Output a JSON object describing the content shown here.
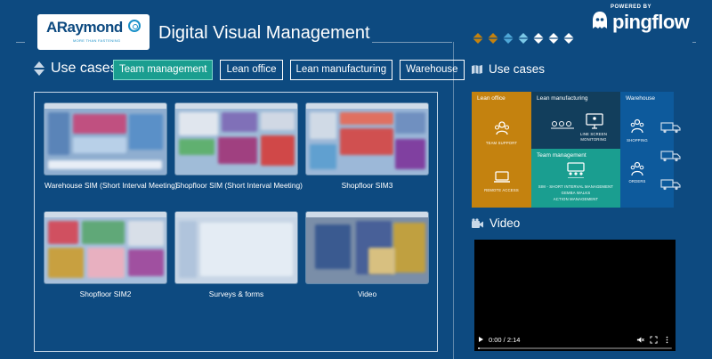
{
  "brand": {
    "logo_text": "ARaymond",
    "logo_tagline": "MORE THAN FASTENING",
    "app_title": "Digital Visual Management",
    "powered_by": "POWERED BY",
    "vendor": "pingflow"
  },
  "colors": {
    "background": "#0d4a80",
    "active_tab": "#1a9e90",
    "lean_office": "#c4820f",
    "lean_manufacturing": "#123e5c",
    "team_management": "#1a9e90",
    "warehouse": "#0d5a9c"
  },
  "left": {
    "section_title": "Use cases",
    "tabs": [
      {
        "label": "Team management",
        "active": true
      },
      {
        "label": "Lean office",
        "active": false
      },
      {
        "label": "Lean manufacturing",
        "active": false
      },
      {
        "label": "Warehouse",
        "active": false
      }
    ],
    "tiles": [
      {
        "label": "Warehouse SIM (Short Interval Meeting)"
      },
      {
        "label": "Shopfloor SIM (Short Interval Meeting)"
      },
      {
        "label": "Shopfloor SIM3"
      },
      {
        "label": "Shopfloor SIM2"
      },
      {
        "label": "Surveys & forms"
      },
      {
        "label": "Video"
      }
    ]
  },
  "right": {
    "section_title": "Use cases",
    "matrix": {
      "lean_office": {
        "title": "Lean office",
        "items": [
          "TEAM SUPPORT",
          "REMOTE ACCESS"
        ]
      },
      "lean_manufacturing": {
        "title": "Lean manufacturing",
        "items": [
          "LINE SCREEN",
          "MONITORING"
        ]
      },
      "team_management": {
        "title": "Team management",
        "items": [
          "SIM - SHORT INTERVAL MANAGEMENT",
          "GEMBA WALKS",
          "ACTION MANAGEMENT"
        ]
      },
      "warehouse": {
        "title": "Warehouse",
        "items": [
          "SHOPPING",
          "ORDERS"
        ]
      }
    },
    "video": {
      "section_title": "Video",
      "current_time": "0:00 / 2:14",
      "progress": 0.0
    }
  }
}
